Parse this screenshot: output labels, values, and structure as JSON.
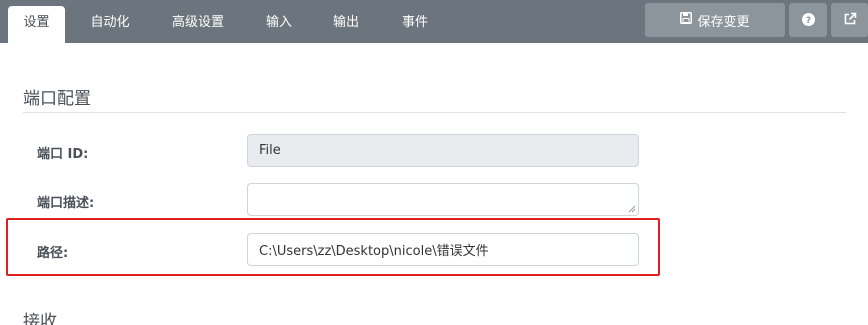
{
  "tabs": [
    {
      "label": "设置"
    },
    {
      "label": "自动化"
    },
    {
      "label": "高级设置"
    },
    {
      "label": "输入"
    },
    {
      "label": "输出"
    },
    {
      "label": "事件"
    }
  ],
  "toolbar": {
    "save_label": "保存变更",
    "help_icon": "question-circle",
    "popout_icon": "external-link"
  },
  "sections": {
    "port_config_title": "端口配置",
    "receive_title": "接收"
  },
  "form": {
    "port_id_label": "端口 ID:",
    "port_id_value": "File",
    "port_desc_label": "端口描述:",
    "port_desc_value": "",
    "path_label": "路径:",
    "path_value": "C:\\Users\\zz\\Desktop\\nicole\\错误文件"
  },
  "colors": {
    "topbar": "#6c757d",
    "button": "#8d959c",
    "highlight": "#e02020"
  }
}
